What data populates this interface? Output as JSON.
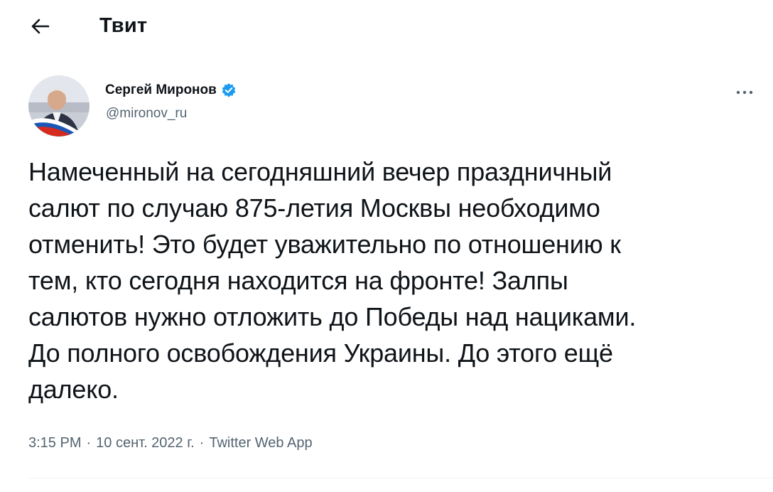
{
  "header": {
    "title": "Твит",
    "back_icon": "arrow-left-icon"
  },
  "tweet": {
    "author": {
      "name": "Сергей Миронов",
      "handle": "@mironov_ru",
      "verified": true,
      "verified_color": "#1d9bf0",
      "avatar_icon": "user-avatar-photo"
    },
    "more_icon": "more-horizontal-icon",
    "text": "Намеченный на сегодняшний вечер праздничный\nсалют по случаю 875-летия Москвы необходимо\nотменить! Это будет уважительно по отношению к\nтем, кто сегодня находится на фронте! Залпы\nсалютов нужно отложить до Победы над нациками.\nДо полного освобождения Украины. До этого ещё\nдалеко.",
    "time": "3:15 PM",
    "date": "10 сент. 2022 г.",
    "separator": "·",
    "source": "Twitter Web App"
  },
  "colors": {
    "text_primary": "#0f1419",
    "text_secondary": "#536471",
    "divider": "#eff3f4",
    "accent": "#1d9bf0"
  }
}
